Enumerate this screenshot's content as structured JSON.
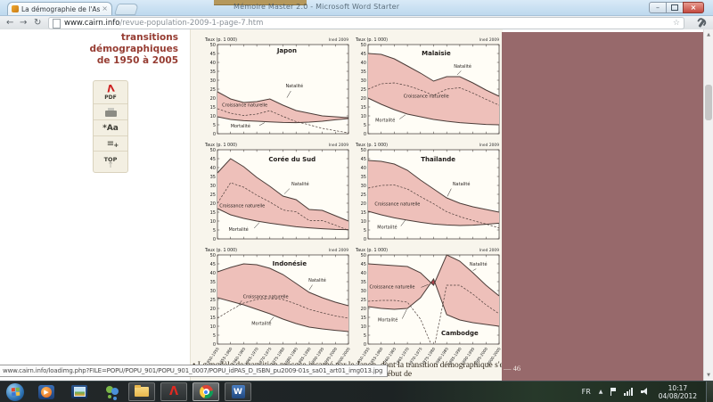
{
  "browser": {
    "tab": {
      "title": "La démographie de l'Asie c",
      "close": "×"
    },
    "background_window_title": "Mémoire Master 2.0 - Microsoft Word Starter",
    "url": {
      "host": "www.cairn.info",
      "path": "/revue-population-2009-1-page-7.htm"
    },
    "nav": {
      "back": "←",
      "forward": "→",
      "reload": "↻",
      "bookmark_star": "☆"
    },
    "window_controls": {
      "minimize": "–",
      "close": "×"
    }
  },
  "page": {
    "sidebar_lines": [
      "transitions",
      "démographiques",
      "de 1950 à 2005"
    ],
    "tools": {
      "pdf_glyph": "Λ",
      "pdf": "PDF",
      "font": "*Aa",
      "list": "≡",
      "list_plus": "+",
      "top": "TOP",
      "top_arrow": "↑"
    },
    "footer": {
      "bullet_line": "•  Le modèle de transition précoce incarné par le Japon, dont la transition démographique s'est",
      "second_line": "mortalité s'est en effet amorcé au début de",
      "page_number": "— 46"
    },
    "status_url": "www.cairn.info/loadimg.php?FILE=POPU/POPU_901/POPU_901_0007/POPU_idPAS_D_ISBN_pu2009-01s_sa01_art01_img013.jpg"
  },
  "chart_data": {
    "type": "area",
    "unit_label": "Taux (p. 1 000)",
    "source_label": "Ined 2009",
    "ylim": [
      0,
      50
    ],
    "y_tick_step": 5,
    "grid": false,
    "legend": "inline-annotations",
    "categories": [
      "1950-1955",
      "1955-1960",
      "1960-1965",
      "1965-1970",
      "1970-1975",
      "1975-1980",
      "1980-1985",
      "1985-1990",
      "1990-1995",
      "1995-2000",
      "2000-2005"
    ],
    "series_colors": {
      "band": "#eec0ba",
      "band_negative": "#b2434d",
      "line": "#4b3c38"
    },
    "charts": [
      {
        "title": "Japon",
        "title_pos": [
          5.3,
          45.5
        ],
        "show_x_labels": false,
        "series": [
          {
            "name": "Natalité",
            "values": [
              23.5,
              19.5,
              17.5,
              18,
              19.5,
              16,
              13,
              11.5,
              10,
              9.5,
              9
            ]
          },
          {
            "name": "Mortalité",
            "values": [
              9.5,
              8,
              7.3,
              7,
              6.6,
              6.3,
              6.2,
              6.5,
              7,
              7.8,
              8.5
            ]
          },
          {
            "name": "Croissance naturelle",
            "values": [
              14,
              11.5,
              10.2,
              11,
              12.9,
              9.7,
              6.8,
              5,
              3,
              1.7,
              0.5
            ]
          }
        ],
        "annotations": [
          {
            "text": "Natalité",
            "tx": 5.2,
            "ty": 26,
            "leader": [
              5.6,
              24,
              5.3,
              20.2
            ]
          },
          {
            "text": "Croissance naturelle",
            "tx": 0.35,
            "ty": 15.2
          },
          {
            "text": "Mortalité",
            "tx": 1.0,
            "ty": 3.4,
            "leader": [
              3.2,
              4.6,
              3.6,
              6.2
            ]
          }
        ]
      },
      {
        "title": "Malaisie",
        "title_pos": [
          5.2,
          44
        ],
        "show_x_labels": false,
        "series": [
          {
            "name": "Natalité",
            "values": [
              45,
              44.5,
              42,
              38,
              34,
              29.5,
              32,
              32,
              28.5,
              24.5,
              21
            ]
          },
          {
            "name": "Mortalité",
            "values": [
              20,
              16.5,
              13.5,
              11,
              9.5,
              8,
              7,
              6.2,
              5.7,
              5.2,
              5
            ]
          },
          {
            "name": "Croissance naturelle",
            "values": [
              25,
              28,
              28.5,
              27,
              24.5,
              21.5,
              25,
              25.8,
              22.8,
              19.3,
              16
            ]
          }
        ],
        "annotations": [
          {
            "text": "Natalité",
            "tx": 6.55,
            "ty": 37,
            "leader": [
              7.1,
              35.3,
              6.8,
              33
            ]
          },
          {
            "text": "Croissance naturelle",
            "tx": 2.7,
            "ty": 20.3
          },
          {
            "text": "Mortalité",
            "tx": 0.55,
            "ty": 6.8,
            "leader": [
              2.4,
              8.2,
              2.85,
              10.6
            ]
          }
        ]
      },
      {
        "title": "Corée du Sud",
        "title_pos": [
          5.7,
          43.5
        ],
        "show_x_labels": false,
        "series": [
          {
            "name": "Natalité",
            "values": [
              37,
              45,
              40.5,
              34.5,
              29.5,
              24,
              22,
              16.5,
              16,
              13,
              10
            ]
          },
          {
            "name": "Mortalité",
            "values": [
              17,
              13.5,
              11.5,
              10,
              8.8,
              7.8,
              6.8,
              6.2,
              5.7,
              5.3,
              5.2
            ]
          },
          {
            "name": "Croissance naturelle",
            "values": [
              20,
              31.5,
              29,
              24.5,
              20.7,
              16.2,
              15.2,
              10.3,
              10.3,
              7.7,
              4.8
            ]
          }
        ],
        "annotations": [
          {
            "text": "Natalité",
            "tx": 5.65,
            "ty": 30,
            "leader": [
              5.5,
              28.2,
              5.1,
              25.2
            ]
          },
          {
            "text": "Croissance naturelle",
            "tx": 0.15,
            "ty": 17.8
          },
          {
            "text": "Mortalité",
            "tx": 0.85,
            "ty": 4.6,
            "leader": [
              2.8,
              6,
              3.2,
              9.2
            ]
          }
        ]
      },
      {
        "title": "Thaïlande",
        "title_pos": [
          5.35,
          43.5
        ],
        "show_x_labels": false,
        "series": [
          {
            "name": "Natalité",
            "values": [
              44,
              43.5,
              42,
              38.5,
              33,
              28,
              23,
              20,
              18,
              16.5,
              15
            ]
          },
          {
            "name": "Mortalité",
            "values": [
              15.5,
              13.5,
              11.8,
              10.5,
              9.3,
              8.3,
              7.8,
              7.5,
              7.7,
              8.2,
              8.8
            ]
          },
          {
            "name": "Croissance naturelle",
            "values": [
              28.5,
              30,
              30.2,
              28,
              23.7,
              19.7,
              15.2,
              12.5,
              10.3,
              8.3,
              6.2
            ]
          }
        ],
        "annotations": [
          {
            "text": "Natalité",
            "tx": 6.45,
            "ty": 30,
            "leader": [
              6.35,
              28.2,
              6.05,
              23.8
            ]
          },
          {
            "text": "Croissance naturelle",
            "tx": 0.5,
            "ty": 18.8
          },
          {
            "text": "Mortalité",
            "tx": 0.7,
            "ty": 5.8,
            "leader": [
              2.5,
              7.2,
              2.85,
              10.6
            ]
          }
        ]
      },
      {
        "title": "Indonésie",
        "title_pos": [
          5.5,
          44
        ],
        "show_x_labels": true,
        "series": [
          {
            "name": "Natalité",
            "values": [
              40.5,
              43,
              45,
              44.5,
              42.5,
              39,
              34,
              29,
              26,
              23.5,
              21.5
            ]
          },
          {
            "name": "Mortalité",
            "values": [
              26,
              24,
              22,
              19.5,
              17,
              14,
              11.5,
              9.5,
              8.5,
              7.7,
              7
            ]
          },
          {
            "name": "Croissance naturelle",
            "values": [
              14.5,
              19,
              23,
              25,
              25.5,
              25,
              22.5,
              19.5,
              17.5,
              15.8,
              14.5
            ]
          }
        ],
        "annotations": [
          {
            "text": "Natalité",
            "tx": 6.95,
            "ty": 35,
            "leader": [
              7.25,
              33.2,
              7.0,
              30.4
            ]
          },
          {
            "text": "Croissance naturelle",
            "tx": 1.95,
            "ty": 25.8,
            "leader": [
              1.85,
              24.4,
              1.6,
              21.6
            ]
          },
          {
            "text": "Mortalité",
            "tx": 2.6,
            "ty": 10.8,
            "leader": [
              3.95,
              12.2,
              4.3,
              15.2
            ]
          }
        ]
      },
      {
        "title": "Cambodge",
        "title_pos": [
          7.0,
          5
        ],
        "show_x_labels": true,
        "series": [
          {
            "name": "Natalité",
            "values": [
              45,
              44.5,
              44,
              43.5,
              40,
              33,
              50,
              46.5,
              40,
              33,
              27
            ]
          },
          {
            "name": "Mortalité",
            "values": [
              21,
              20,
              19.5,
              20,
              26,
              36.5,
              16.5,
              13.5,
              12,
              11,
              10
            ]
          },
          {
            "name": "Croissance naturelle",
            "values": [
              24,
              24.5,
              24.5,
              23.5,
              14,
              -3.5,
              33,
              33,
              28,
              22,
              17
            ]
          }
        ],
        "annotations": [
          {
            "text": "Natalité",
            "tx": 7.75,
            "ty": 44,
            "leader": [
              8.25,
              42.2,
              8.0,
              41.2
            ]
          },
          {
            "text": "Croissance naturelle",
            "tx": 0.1,
            "ty": 31.2,
            "leader": [
              4.05,
              31.8,
              4.6,
              33.4
            ]
          },
          {
            "text": "Mortalité",
            "tx": 0.75,
            "ty": 12.8,
            "leader": [
              2.6,
              14.2,
              2.95,
              19.4
            ]
          }
        ]
      }
    ]
  },
  "taskbar": {
    "language": "FR",
    "chevron": "▲",
    "time": "10:17",
    "date": "04/08/2012"
  }
}
